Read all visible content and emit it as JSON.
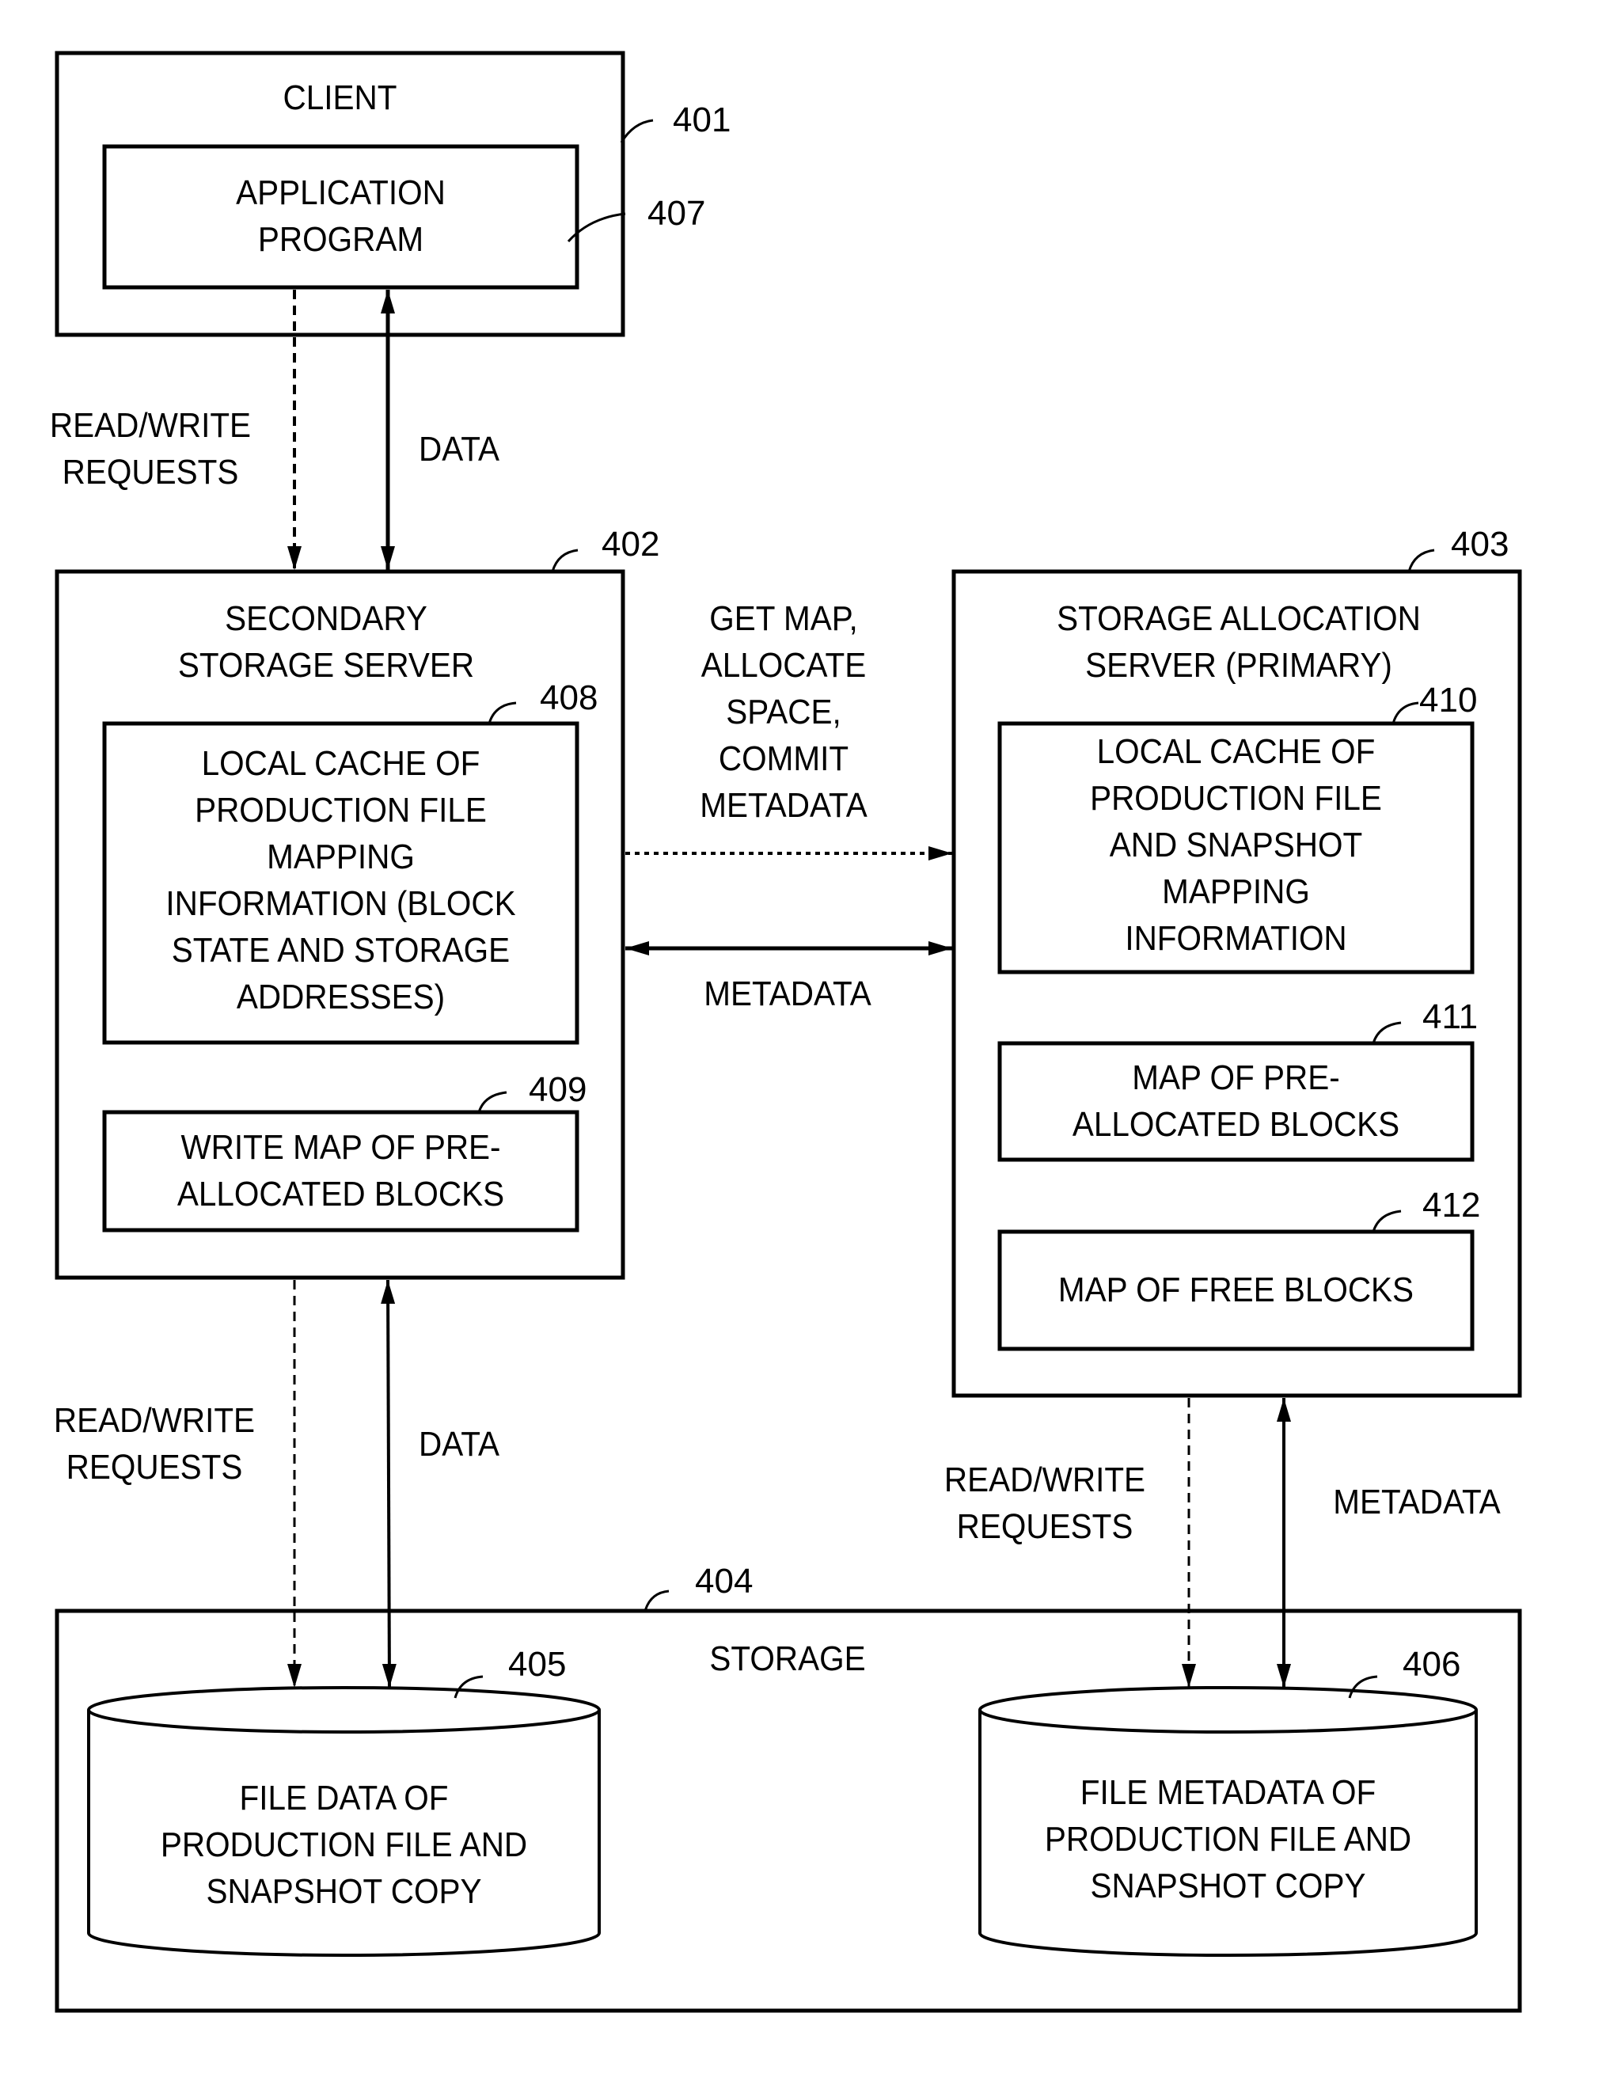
{
  "figure": {
    "client": {
      "label": "CLIENT",
      "ref": "401"
    },
    "application_program": {
      "label": "APPLICATION\nPROGRAM",
      "ref": "407"
    },
    "secondary_server": {
      "label": "SECONDARY\nSTORAGE SERVER",
      "ref": "402"
    },
    "local_cache_secondary": {
      "label": "LOCAL CACHE OF\nPRODUCTION FILE\nMAPPING\nINFORMATION (BLOCK\nSTATE AND STORAGE\nADDRESSES)",
      "ref": "408"
    },
    "write_map": {
      "label": "WRITE MAP OF PRE-\nALLOCATED BLOCKS",
      "ref": "409"
    },
    "primary_server": {
      "label": "STORAGE ALLOCATION\nSERVER (PRIMARY)",
      "ref": "403"
    },
    "local_cache_primary": {
      "label": "LOCAL CACHE OF\nPRODUCTION FILE\nAND SNAPSHOT\nMAPPING\nINFORMATION",
      "ref": "410"
    },
    "preallocated_map": {
      "label": "MAP OF PRE-\nALLOCATED BLOCKS",
      "ref": "411"
    },
    "free_blocks_map": {
      "label": "MAP OF FREE BLOCKS",
      "ref": "412"
    },
    "storage": {
      "label": "STORAGE",
      "ref": "404"
    },
    "file_data": {
      "label": "FILE DATA OF\nPRODUCTION FILE AND\nSNAPSHOT COPY",
      "ref": "405"
    },
    "file_metadata": {
      "label": "FILE METADATA OF\nPRODUCTION FILE AND\nSNAPSHOT COPY",
      "ref": "406"
    },
    "edges": {
      "client_rw": "READ/WRITE\nREQUESTS",
      "client_data": "DATA",
      "get_map": "GET MAP,\nALLOCATE\nSPACE,\nCOMMIT\nMETADATA",
      "metadata_mid": "METADATA",
      "secondary_rw": "READ/WRITE\nREQUESTS",
      "secondary_data": "DATA",
      "primary_rw": "READ/WRITE\nREQUESTS",
      "primary_metadata": "METADATA"
    }
  }
}
